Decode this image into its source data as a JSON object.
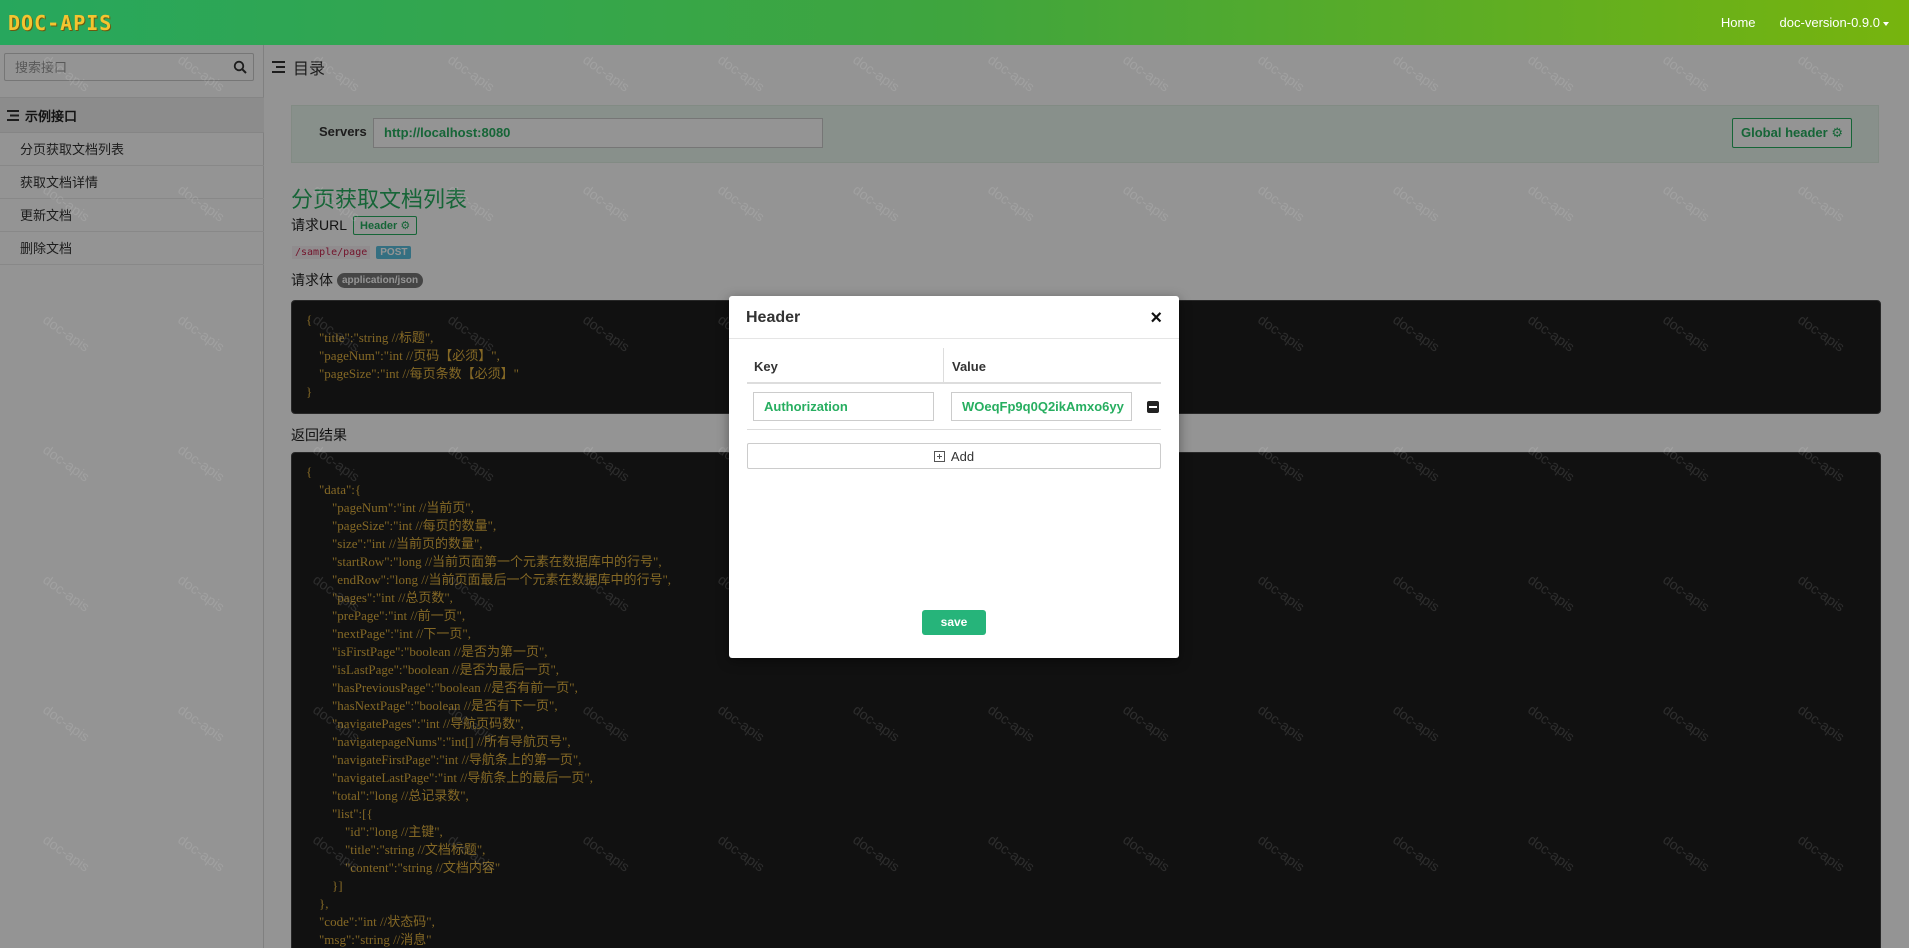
{
  "navbar": {
    "brand": "DOC-APIS",
    "home": "Home",
    "version": "doc-version-0.9.0"
  },
  "sidebar": {
    "search_placeholder": "搜索接口",
    "group_label": "示例接口",
    "items": [
      {
        "label": "分页获取文档列表"
      },
      {
        "label": "获取文档详情"
      },
      {
        "label": "更新文档"
      },
      {
        "label": "删除文档"
      }
    ]
  },
  "main": {
    "toc_label": "目录",
    "servers_label": "Servers",
    "servers_value": "http://localhost:8080",
    "global_header_label": "Global header",
    "api_title": "分页获取文档列表",
    "request_url_label": "请求URL",
    "header_btn_label": "Header",
    "path": "/sample/page",
    "method": "POST",
    "request_body_label": "请求体",
    "content_type": "application/json",
    "request_body_code": "{\n    \"title\":\"string //标题\",\n    \"pageNum\":\"int //页码【必须】\",\n    \"pageSize\":\"int //每页条数【必须】\"\n}",
    "response_label": "返回结果",
    "response_code": "{\n    \"data\":{\n        \"pageNum\":\"int //当前页\",\n        \"pageSize\":\"int //每页的数量\",\n        \"size\":\"int //当前页的数量\",\n        \"startRow\":\"long //当前页面第一个元素在数据库中的行号\",\n        \"endRow\":\"long //当前页面最后一个元素在数据库中的行号\",\n        \"pages\":\"int //总页数\",\n        \"prePage\":\"int //前一页\",\n        \"nextPage\":\"int //下一页\",\n        \"isFirstPage\":\"boolean //是否为第一页\",\n        \"isLastPage\":\"boolean //是否为最后一页\",\n        \"hasPreviousPage\":\"boolean //是否有前一页\",\n        \"hasNextPage\":\"boolean //是否有下一页\",\n        \"navigatePages\":\"int //导航页码数\",\n        \"navigatepageNums\":\"int[] //所有导航页号\",\n        \"navigateFirstPage\":\"int //导航条上的第一页\",\n        \"navigateLastPage\":\"int //导航条上的最后一页\",\n        \"total\":\"long //总记录数\",\n        \"list\":[{\n            \"id\":\"long //主键\",\n            \"title\":\"string //文档标题\",\n            \"content\":\"string //文档内容\"\n        }]\n    },\n    \"code\":\"int //状态码\",\n    \"msg\":\"string //消息\""
  },
  "watermark": "doc-apis",
  "modal": {
    "title": "Header",
    "close": "×",
    "key_header": "Key",
    "value_header": "Value",
    "rows": [
      {
        "key": "Authorization",
        "value": "WOeqFp9q0Q2ikAmxo6yy"
      }
    ],
    "add_label": "Add",
    "save_label": "save"
  }
}
